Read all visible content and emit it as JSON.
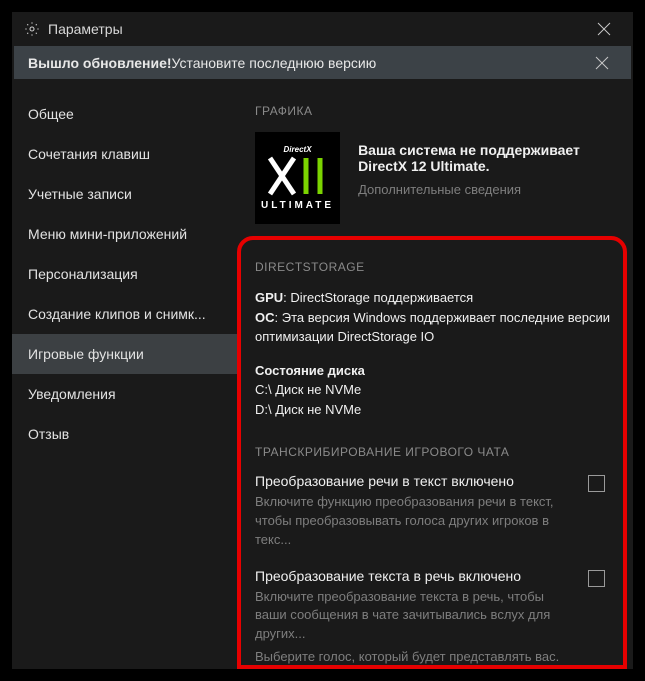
{
  "titlebar": {
    "title": "Параметры"
  },
  "notification": {
    "part1": "Вышло обновление! ",
    "part2": "Установите последнюю версию"
  },
  "sidebar": {
    "items": [
      {
        "label": "Общее"
      },
      {
        "label": "Сочетания клавиш"
      },
      {
        "label": "Учетные записи"
      },
      {
        "label": "Меню мини-приложений"
      },
      {
        "label": "Персонализация"
      },
      {
        "label": "Создание клипов и снимк..."
      },
      {
        "label": "Игровые функции"
      },
      {
        "label": "Уведомления"
      },
      {
        "label": "Отзыв"
      }
    ],
    "selected_index": 6
  },
  "graphics": {
    "heading": "ГРАФИКА",
    "badge_top": "DirectX",
    "badge_bottom": "ULTIMATE",
    "message": "Ваша система не поддерживает DirectX 12 Ultimate.",
    "more_link": "Дополнительные сведения"
  },
  "directstorage": {
    "heading": "DIRECTSTORAGE",
    "gpu_label": "GPU",
    "gpu_text": ": DirectStorage поддерживается",
    "os_label": "ОС",
    "os_text": ": Эта версия Windows поддерживает последние версии оптимизации DirectStorage IO",
    "disk_heading": "Состояние диска",
    "disk_c": "C:\\ Диск не NVMe",
    "disk_d": "D:\\ Диск не NVMe"
  },
  "chat": {
    "heading": "ТРАНСКРИБИРОВАНИЕ ИГРОВОГО ЧАТА",
    "items": [
      {
        "title": "Преобразование речи в текст включено",
        "desc": "Включите функцию преобразования речи в текст, чтобы преобразовывать голоса других игроков в текс...",
        "checked": false
      },
      {
        "title": "Преобразование текста в речь включено",
        "desc": "Включите преобразование текста в речь, чтобы ваши сообщения в чате зачитывались вслух для других...",
        "desc2": "Выберите голос, который будет представлять вас. Этот",
        "checked": false
      }
    ]
  }
}
